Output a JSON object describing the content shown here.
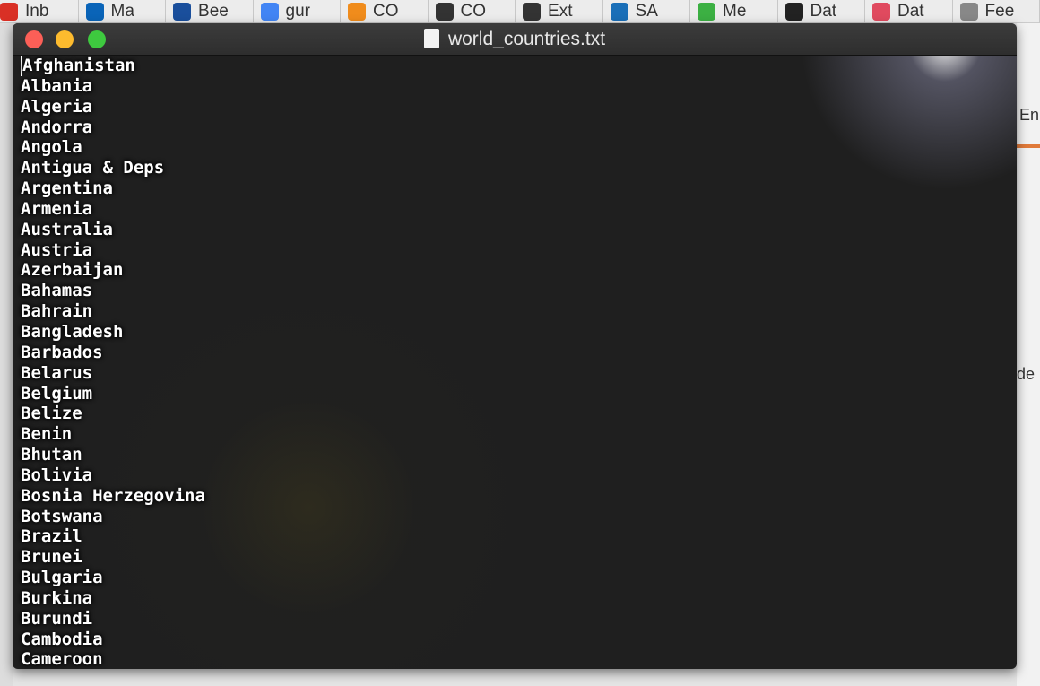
{
  "bookmarks": [
    {
      "label": "Inb",
      "icon": "gmail-icon",
      "color": "#d93025"
    },
    {
      "label": "Ma",
      "icon": "outlook-icon",
      "color": "#0a64b8"
    },
    {
      "label": "Bee",
      "icon": "video-icon",
      "color": "#1a4f9c"
    },
    {
      "label": "gur",
      "icon": "google-icon",
      "color": "#4285f4"
    },
    {
      "label": "CO",
      "icon": "moodle-icon",
      "color": "#f08c1c"
    },
    {
      "label": "CO",
      "icon": "globe-icon",
      "color": "#333333"
    },
    {
      "label": "Ext",
      "icon": "globe-icon",
      "color": "#333333"
    },
    {
      "label": "SA",
      "icon": "sa-icon",
      "color": "#1a6fb8"
    },
    {
      "label": "Me",
      "icon": "meetup-icon",
      "color": "#3cb043"
    },
    {
      "label": "Dat",
      "icon": "medium-icon",
      "color": "#222222"
    },
    {
      "label": "Dat",
      "icon": "youtube-icon",
      "color": "#e04a5f"
    },
    {
      "label": "Fee",
      "icon": "wikipedia-icon",
      "color": "#888888"
    }
  ],
  "background": {
    "right_top": "En",
    "right_mid": "de"
  },
  "window": {
    "title": "world_countries.txt",
    "icon": "text-file-icon"
  },
  "lines": [
    "Afghanistan",
    "Albania",
    "Algeria",
    "Andorra",
    "Angola",
    "Antigua & Deps",
    "Argentina",
    "Armenia",
    "Australia",
    "Austria",
    "Azerbaijan",
    "Bahamas",
    "Bahrain",
    "Bangladesh",
    "Barbados",
    "Belarus",
    "Belgium",
    "Belize",
    "Benin",
    "Bhutan",
    "Bolivia",
    "Bosnia Herzegovina",
    "Botswana",
    "Brazil",
    "Brunei",
    "Bulgaria",
    "Burkina",
    "Burundi",
    "Cambodia",
    "Cameroon"
  ]
}
